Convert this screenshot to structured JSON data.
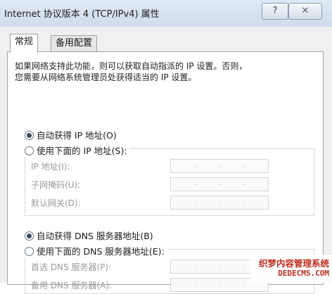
{
  "window": {
    "title": "Internet 协议版本 4 (TCP/IPv4) 属性",
    "help_label": "?",
    "close_label": "✕"
  },
  "tabs": [
    {
      "label": "常规",
      "active": true
    },
    {
      "label": "备用配置",
      "active": false
    }
  ],
  "description": {
    "line1": "如果网络支持此功能，则可以获取自动指派的 IP 设置。否则，",
    "line2": "您需要从网络系统管理员处获得适当的 IP 设置。"
  },
  "ip": {
    "auto_label": "自动获得 IP 地址(O)",
    "auto_checked": true,
    "manual_label": "使用下面的 IP 地址(S):",
    "manual_checked": false,
    "fields": [
      {
        "label": "IP 地址(I):",
        "value": ""
      },
      {
        "label": "子网掩码(U):",
        "value": ""
      },
      {
        "label": "默认网关(D):",
        "value": ""
      }
    ]
  },
  "dns": {
    "auto_label": "自动获得 DNS 服务器地址(B)",
    "auto_checked": true,
    "manual_label": "使用下面的 DNS 服务器地址(E):",
    "manual_checked": false,
    "fields": [
      {
        "label": "首选 DNS 服务器(P):",
        "value": ""
      },
      {
        "label": "备用 DNS 服务器(A):",
        "value": ""
      }
    ]
  },
  "watermark": {
    "line1": "织梦内容管理系统",
    "line2": "DEDECMS.COM"
  }
}
